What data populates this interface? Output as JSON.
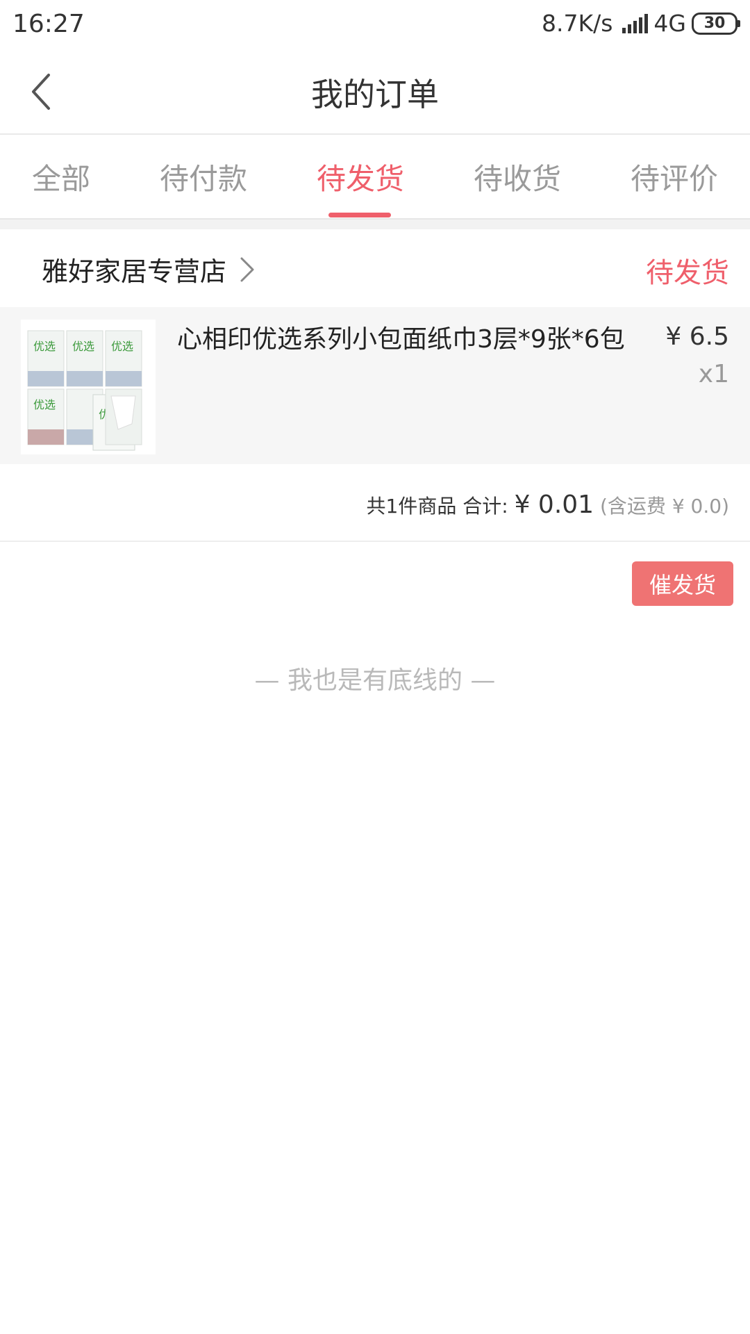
{
  "status_bar": {
    "time": "16:27",
    "network_speed": "8.7K/s",
    "network_type": "4G",
    "battery": "30"
  },
  "header": {
    "title": "我的订单",
    "back_icon": "chevron-left-icon"
  },
  "tabs": [
    {
      "label": "全部",
      "active": false
    },
    {
      "label": "待付款",
      "active": false
    },
    {
      "label": "待发货",
      "active": true
    },
    {
      "label": "待收货",
      "active": false
    },
    {
      "label": "待评价",
      "active": false
    }
  ],
  "order": {
    "store_name": "雅好家居专营店",
    "status": "待发货",
    "product": {
      "title": "心相印优选系列小包面纸巾3层*9张*6包",
      "price": "¥ 6.5",
      "quantity": "x1"
    },
    "summary": {
      "count_text": "共1件商品 合计:",
      "total": "¥ 0.01",
      "shipping": "(含运费 ¥ 0.0)"
    },
    "action_button": "催发货"
  },
  "footer_note": "— 我也是有底线的 —",
  "colors": {
    "accent": "#ef5f6b",
    "button": "#ef7373",
    "muted_text": "#9a9a9a"
  }
}
